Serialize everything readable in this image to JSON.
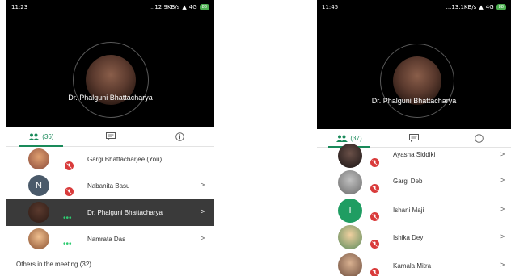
{
  "left": {
    "status": {
      "time": "11:23",
      "network": "...12.9KB/s",
      "signal": "4G",
      "battery": "88"
    },
    "speaker_name": "Dr. Phalguni Bhattacharya",
    "tabs": [
      {
        "label": "(36)",
        "icon": "people-icon"
      },
      {
        "label": "",
        "icon": "chat-icon"
      },
      {
        "label": "",
        "icon": "info-icon"
      }
    ],
    "participants": [
      {
        "name": "Gargi Bhattacharjee (You)",
        "avatar": "photo",
        "color": "#b07a5a",
        "muted": true,
        "speaking": false,
        "chevron": false,
        "highlight": false
      },
      {
        "name": "Nabanita Basu",
        "avatar": "N",
        "color": "#4a5a6a",
        "muted": true,
        "speaking": false,
        "chevron": true,
        "highlight": false
      },
      {
        "name": "Dr. Phalguni Bhattacharya",
        "avatar": "photo",
        "color": "#4a3028",
        "muted": false,
        "speaking": true,
        "chevron": true,
        "highlight": true
      },
      {
        "name": "Namrata Das",
        "avatar": "photo",
        "color": "#c98f5a",
        "muted": false,
        "speaking": true,
        "chevron": true,
        "highlight": false
      }
    ],
    "others_label": "Others in the meeting (32)"
  },
  "right": {
    "status": {
      "time": "11:45",
      "network": "...13.1KB/s",
      "signal": "4G",
      "battery": "88"
    },
    "speaker_name": "Dr. Phalguni Bhattacharya",
    "tabs": [
      {
        "label": "(37)",
        "icon": "people-icon"
      },
      {
        "label": "",
        "icon": "chat-icon"
      },
      {
        "label": "",
        "icon": "info-icon"
      }
    ],
    "participants": [
      {
        "name": "Ayasha Siddiki",
        "avatar": "photo",
        "color": "#3a3030",
        "muted": true
      },
      {
        "name": "Gargi Deb",
        "avatar": "photo",
        "color": "#8a8a8a",
        "muted": true
      },
      {
        "name": "Ishani Maji",
        "avatar": "I",
        "color": "#1f9d62",
        "muted": true
      },
      {
        "name": "Ishika Dey",
        "avatar": "photo",
        "color": "#c9a070",
        "muted": true
      },
      {
        "name": "Kamala Mitra",
        "avatar": "photo",
        "color": "#9a7a6a",
        "muted": true
      }
    ]
  },
  "colors": {
    "accent": "#1a8a5a",
    "mic_off": "#d93b3b",
    "speaking_dots": "#2ecc71",
    "call_bg": "#000000"
  }
}
